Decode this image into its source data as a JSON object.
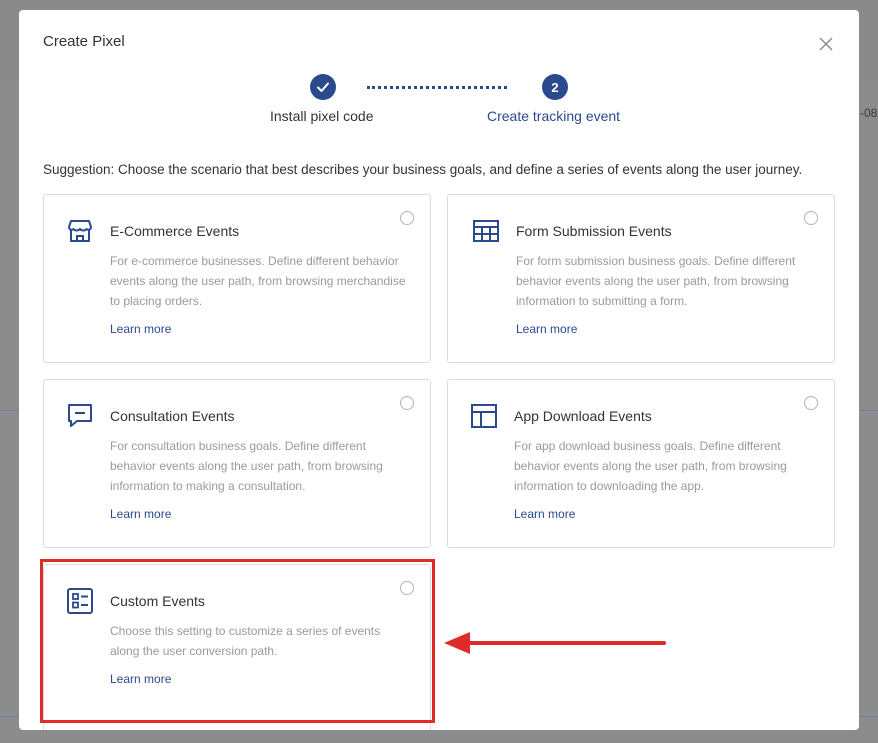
{
  "background": {
    "partial_text": "-08"
  },
  "modal": {
    "title": "Create Pixel",
    "close_icon": "close-icon"
  },
  "steps": [
    {
      "number": "1",
      "label": "Install pixel code",
      "state": "completed",
      "icon": "check-icon"
    },
    {
      "number": "2",
      "label": "Create tracking event",
      "state": "active"
    }
  ],
  "suggestion": "Suggestion: Choose the scenario that best describes your business goals, and define a series of events along the user journey.",
  "cards": [
    {
      "icon": "storefront-icon",
      "title": "E-Commerce Events",
      "desc_lines": [
        "For e-commerce businesses. Define different behavior",
        "events along the user path, from browsing merchandise",
        "to placing orders."
      ],
      "learn_more": "Learn more",
      "selected": false
    },
    {
      "icon": "table-icon",
      "title": "Form Submission Events",
      "desc_lines": [
        "For form submission business goals. Define different",
        "behavior events along the user path, from browsing",
        "information to submitting a form."
      ],
      "learn_more": "Learn more",
      "selected": false
    },
    {
      "icon": "chat-icon",
      "title": "Consultation Events",
      "desc_lines": [
        "For consultation business goals. Define different",
        "behavior events along the user path, from browsing",
        "information to making a consultation."
      ],
      "learn_more": "Learn more",
      "selected": false
    },
    {
      "icon": "layout-icon",
      "title": "App Download Events",
      "desc_lines": [
        "For app download business goals. Define different",
        "behavior events along the user path, from browsing",
        "information to downloading the app."
      ],
      "learn_more": "Learn more",
      "selected": false
    },
    {
      "icon": "checklist-icon",
      "title": "Custom Events",
      "desc_lines": [
        "Choose this setting to customize a series of events",
        "along the user conversion path."
      ],
      "learn_more": "Learn more",
      "selected": false
    }
  ],
  "annotation": {
    "highlight_color": "#e02b2b",
    "arrow_color": "#e02b2b"
  },
  "colors": {
    "accent": "#2b4a8e",
    "text": "#333333",
    "muted": "#9a9a9a",
    "border": "#dcdcdc"
  }
}
